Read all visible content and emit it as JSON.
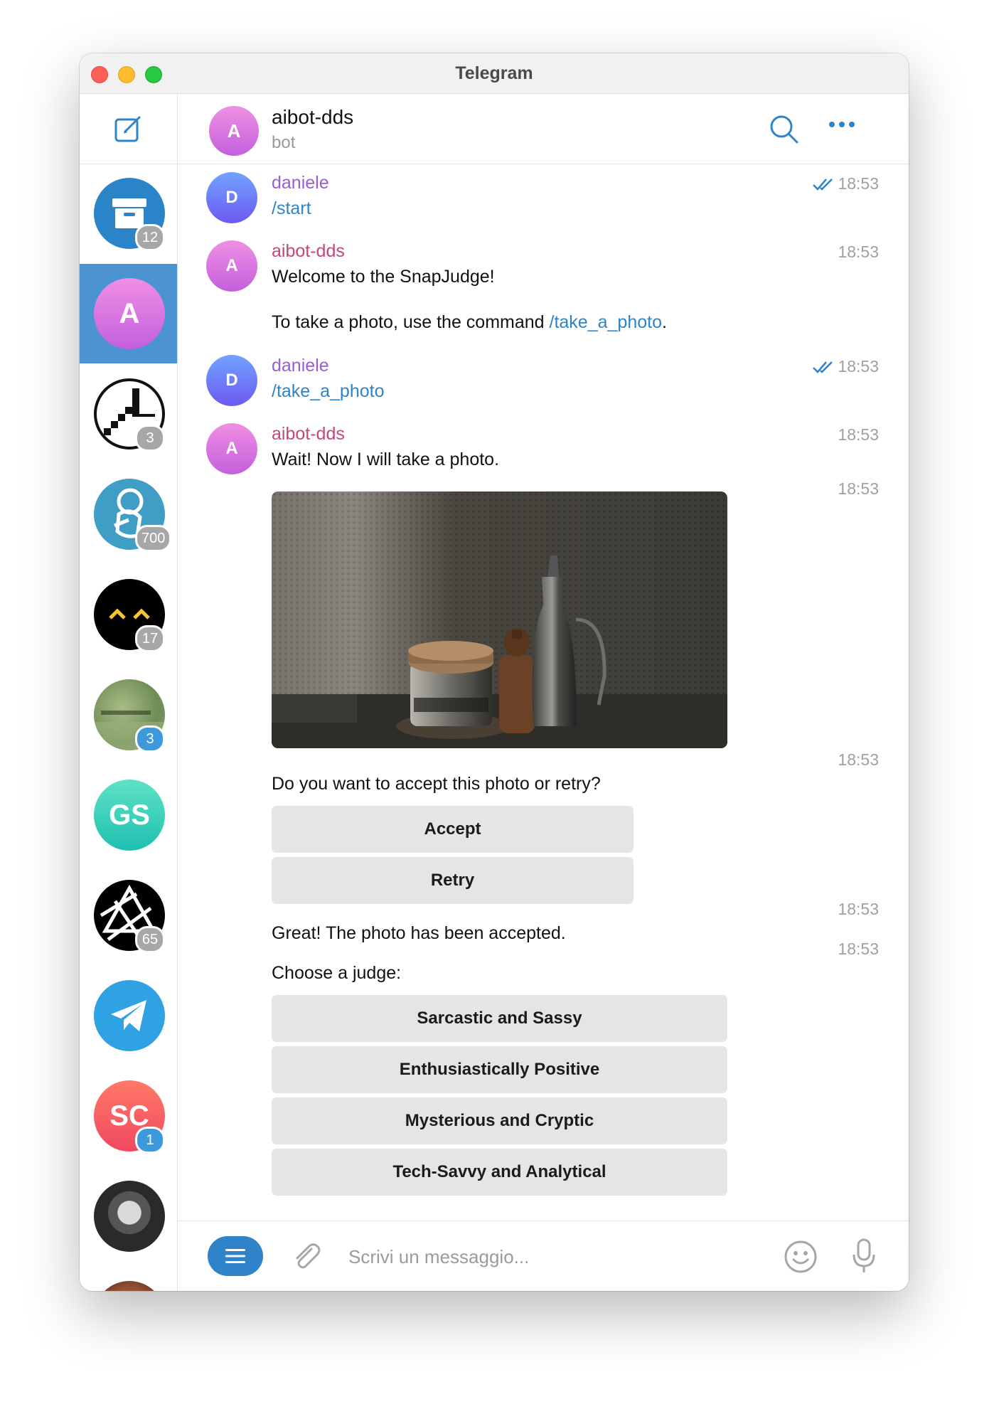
{
  "window": {
    "title": "Telegram"
  },
  "sidebar": {
    "compose_icon": "compose-icon",
    "chats": [
      {
        "kind": "archive",
        "badge": "12",
        "badge_color": "grey"
      },
      {
        "initial": "A",
        "active": true
      },
      {
        "kind": "pixel-logo",
        "badge": "3",
        "badge_color": "grey"
      },
      {
        "kind": "illustrated-figure",
        "badge": "700",
        "badge_color": "grey"
      },
      {
        "kind": "dark-face",
        "badge": "17",
        "badge_color": "grey"
      },
      {
        "kind": "landscape-photo",
        "badge": "3",
        "badge_color": "blue"
      },
      {
        "initial": "GS"
      },
      {
        "kind": "geometric-logo",
        "badge": "65",
        "badge_color": "grey"
      },
      {
        "kind": "telegram-logo"
      },
      {
        "initial": "SC",
        "badge": "1",
        "badge_color": "blue"
      },
      {
        "kind": "portrait-photo"
      },
      {
        "kind": "partial-photo"
      }
    ]
  },
  "header": {
    "avatar_initial": "A",
    "name": "aibot-dds",
    "status": "bot",
    "search_icon": "search-icon",
    "more_icon": "more-icon"
  },
  "messages": [
    {
      "avatar": "D",
      "sender": "daniele",
      "text": "/start",
      "time": "18:53",
      "read": true
    },
    {
      "avatar": "A",
      "sender": "aibot-dds",
      "line1": "Welcome to the SnapJudge!",
      "line2_prefix": "To take a photo, use the command ",
      "line2_link": "/take_a_photo",
      "line2_suffix": ".",
      "time": "18:53"
    },
    {
      "avatar": "D",
      "sender": "daniele",
      "text": "/take_a_photo",
      "time": "18:53",
      "read": true
    },
    {
      "avatar": "A",
      "sender": "aibot-dds",
      "text": "Wait! Now I will take a photo.",
      "time": "18:53"
    },
    {
      "type": "photo",
      "time": "18:53"
    },
    {
      "text": "Do you want to accept this photo or retry?",
      "time": "18:53",
      "buttons": [
        "Accept",
        "Retry"
      ]
    },
    {
      "text": "Great! The photo has been accepted.",
      "time": "18:53"
    },
    {
      "text": "Choose a judge:",
      "time": "18:53",
      "buttons": [
        "Sarcastic and Sassy",
        "Enthusiastically Positive",
        "Mysterious and Cryptic",
        "Tech-Savvy and Analytical"
      ]
    }
  ],
  "composer": {
    "placeholder": "Scrivi un messaggio...",
    "value": ""
  },
  "colors": {
    "accent": "#2f83c8",
    "active_chat": "#4b94d1",
    "bot_name": "#c3467c",
    "user_name": "#9c5cd1"
  }
}
